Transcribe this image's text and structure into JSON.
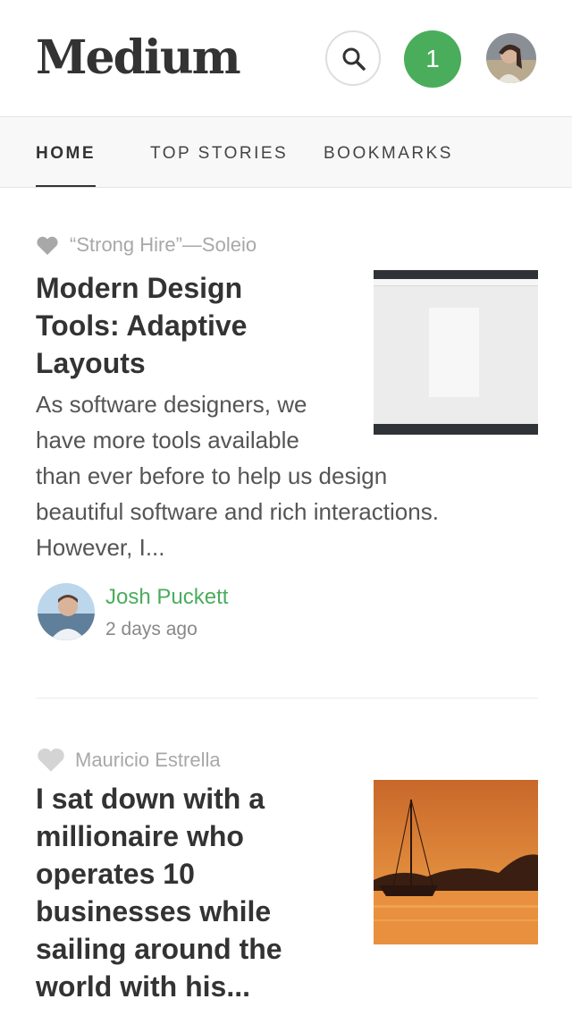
{
  "app": {
    "logo": "Medium",
    "notification_count": "1"
  },
  "colors": {
    "accent": "#4aad5c",
    "text": "#333333",
    "muted": "#a8a8a8"
  },
  "header": {
    "search_icon": "search-icon",
    "user_avatar": "avatar"
  },
  "tabs": [
    {
      "label": "HOME",
      "active": true
    },
    {
      "label": "TOP STORIES",
      "active": false
    },
    {
      "label": "BOOKMARKS",
      "active": false
    }
  ],
  "posts": [
    {
      "kicker": "“Strong Hire”—Soleio",
      "kicker_icon": "heart-icon",
      "title": "Modern Design Tools: Adaptive Layouts",
      "title_lines": [
        "Modern Design",
        "Tools: Adaptive",
        "Layouts"
      ],
      "excerpt_lines": [
        "As software designers, we",
        "have more tools available",
        "than ever before to help us design",
        "beautiful software and rich interactions.",
        "However, I..."
      ],
      "author": "Josh Puckett",
      "date": "2 days ago"
    },
    {
      "kicker": "Mauricio Estrella",
      "kicker_icon": "heart-icon",
      "title": "I sat down with a millionaire who operates 10 businesses while sailing around the world with his...",
      "title_lines": [
        "I sat down with a",
        "millionaire who",
        "operates 10",
        "businesses while",
        "sailing around the",
        "world with his..."
      ]
    }
  ]
}
